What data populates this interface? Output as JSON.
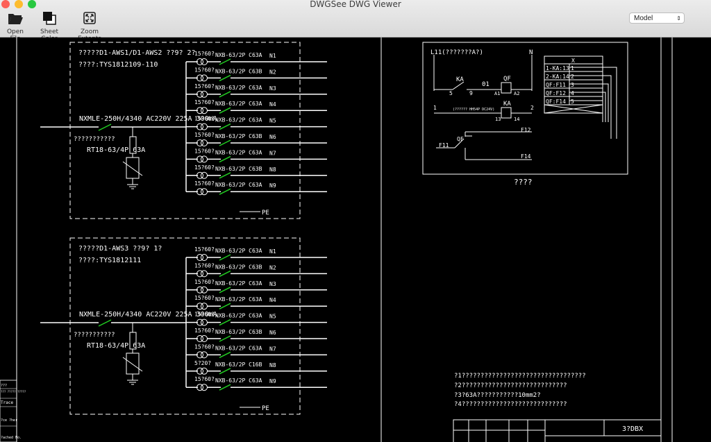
{
  "window": {
    "title": "DWGSee DWG Viewer"
  },
  "colors": {
    "background": "#000000",
    "lines": "#ffffff",
    "breaker": "#22cc22"
  },
  "toolbar": {
    "open_file": "Open File",
    "sheet_color": "Sheet Color",
    "zoom_extents": "Zoom Extents",
    "model_selected": "Model"
  },
  "panel1": {
    "title": "?????D1-AWS1/D1-AWS2 ??9? 2?",
    "model": "????:TYS1812109-110",
    "main_breaker": "NXMLE-250H/4340 AC220V 225A 300mA",
    "spd_note": "???????????",
    "spd_model": "RT18-63/4P 63A",
    "pe": "PE",
    "circuits": [
      {
        "rating": "15?60?",
        "breaker": "NXB-63/2P C63A",
        "id": "N1"
      },
      {
        "rating": "15?60?",
        "breaker": "NXB-63/2P C63B",
        "id": "N2"
      },
      {
        "rating": "15?60?",
        "breaker": "NXB-63/2P C63A",
        "id": "N3"
      },
      {
        "rating": "15?60?",
        "breaker": "NXB-63/2P C63A",
        "id": "N4"
      },
      {
        "rating": "15?60?",
        "breaker": "NXB-63/2P C63A",
        "id": "N5"
      },
      {
        "rating": "15?60?",
        "breaker": "NXB-63/2P C63B",
        "id": "N6"
      },
      {
        "rating": "15?60?",
        "breaker": "NXB-63/2P C63A",
        "id": "N7"
      },
      {
        "rating": "15?60?",
        "breaker": "NXB-63/2P C63B",
        "id": "N8"
      },
      {
        "rating": "15?60?",
        "breaker": "NXB-63/2P C63A",
        "id": "N9"
      }
    ]
  },
  "panel2": {
    "title": "?????D1-AWS3 ??9? 1?",
    "model": "????:TYS1812111",
    "main_breaker": "NXMLE-250H/4340 AC220V 225A 300mA",
    "spd_note": "???????????",
    "spd_model": "RT18-63/4P 63A",
    "pe": "PE",
    "circuits": [
      {
        "rating": "15?60?",
        "breaker": "NXB-63/2P C63A",
        "id": "N1"
      },
      {
        "rating": "15?60?",
        "breaker": "NXB-63/2P C63B",
        "id": "N2"
      },
      {
        "rating": "15?60?",
        "breaker": "NXB-63/2P C63A",
        "id": "N3"
      },
      {
        "rating": "15?60?",
        "breaker": "NXB-63/2P C63A",
        "id": "N4"
      },
      {
        "rating": "15?60?",
        "breaker": "NXB-63/2P C63A",
        "id": "N5"
      },
      {
        "rating": "15?60?",
        "breaker": "NXB-63/2P C63B",
        "id": "N6"
      },
      {
        "rating": "15?60?",
        "breaker": "NXB-63/2P C63A",
        "id": "N7"
      },
      {
        "rating": "5?20?",
        "breaker": "NXB-63/2P C16B",
        "id": "N8"
      },
      {
        "rating": "15?60?",
        "breaker": "NXB-63/2P C63A",
        "id": "N9"
      }
    ]
  },
  "control": {
    "l11": "L11(???????A?)",
    "n": "N",
    "ka": "KA",
    "n5": "5",
    "n9": "9",
    "n01": "01",
    "qf": "QF",
    "a1": "A1",
    "a2": "A2",
    "n1": "1",
    "coil_note": "(?????? HH54P DC24V)",
    "n2": "2",
    "n13": "13",
    "n14": "14",
    "f11": "F11",
    "f12": "F12",
    "f14": "F14",
    "caption": "????",
    "terminal_head": "X",
    "terminals": [
      {
        "label": "1-KA:13",
        "num": "1"
      },
      {
        "label": "2-KA:14",
        "num": "2"
      },
      {
        "label": "QF:F11",
        "num": "3"
      },
      {
        "label": "QF:F12",
        "num": "4"
      },
      {
        "label": "QF:F14",
        "num": "5"
      }
    ]
  },
  "notes": [
    "?1?????????????????????????????????",
    "?2????????????????????????????",
    "?3?63A???????????10mm2?",
    "?4????????????????????????????"
  ],
  "title_block": {
    "code": "3?DBX"
  },
  "left_strip": [
    "???",
    "??? ????? ?????",
    "Trace",
    "?ce ?her",
    "?ached No."
  ]
}
